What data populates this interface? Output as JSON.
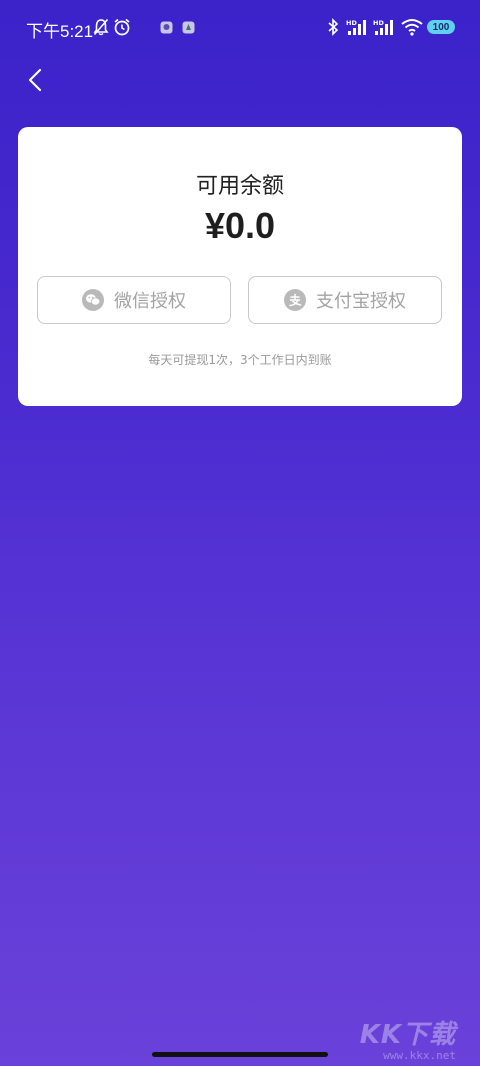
{
  "status_bar": {
    "time": "下午5:21",
    "battery": "100",
    "icons": [
      "bell-off-icon",
      "alarm-icon",
      "app-notification-icon",
      "app-notification-icon",
      "bluetooth-icon",
      "signal-hd-icon",
      "signal-hd-icon",
      "wifi-icon",
      "battery-icon"
    ]
  },
  "nav": {
    "back_icon": "chevron-left-icon"
  },
  "balance": {
    "label": "可用余额",
    "amount": "¥0.0"
  },
  "auth_buttons": [
    {
      "label": "微信授权",
      "icon": "wechat-icon"
    },
    {
      "label": "支付宝授权",
      "icon": "alipay-icon"
    }
  ],
  "notice": "每天可提现1次，3个工作日内到账",
  "watermark": {
    "logo": "KK下载",
    "url": "www.kkx.net"
  },
  "colors": {
    "bg_top": "#3b22c9",
    "bg_bottom": "#6a41d9",
    "card": "#ffffff",
    "button_text": "#a3a3a3"
  }
}
